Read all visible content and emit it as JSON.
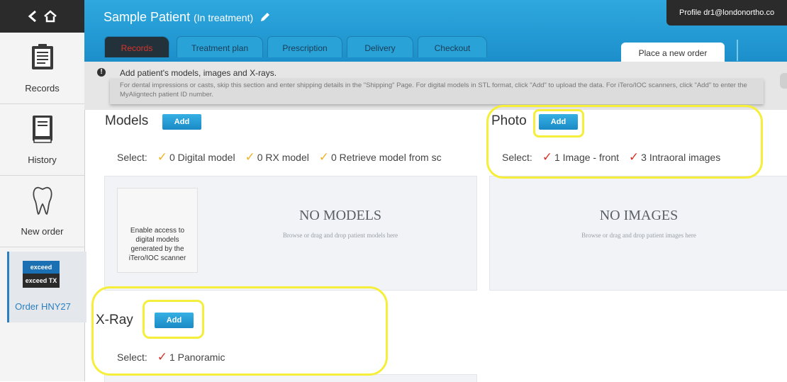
{
  "sidebar": {
    "records": "Records",
    "history": "History",
    "new_order": "New order",
    "order_badge_top": "exceed",
    "order_badge_bottom": "exceed TX",
    "order_id": "Order HNY27"
  },
  "header": {
    "patient_name": "Sample Patient",
    "status": "(In treatment)",
    "profile": "Profile  dr1@londonortho.co"
  },
  "tabs": [
    "Records",
    "Treatment plan",
    "Prescription",
    "Delivery",
    "Checkout"
  ],
  "place_order": "Place a new order",
  "info": {
    "title": "Add patient's models, images and X-rays.",
    "text": "For dental impressions or casts, skip this section and enter shipping details in the \"Shipping\" Page. For digital models in STL format, click \"Add\" to upload the data. For iTero/IOC scanners, click \"Add\" to enter the MyAligntech patient ID number."
  },
  "add_label": "Add",
  "select_label": "Select:",
  "models": {
    "title": "Models",
    "options": [
      "0 Digital model",
      "0 RX model",
      "0 Retrieve model from sc"
    ],
    "empty_title": "NO MODELS",
    "empty_hint": "Browse or drag and drop patient models here",
    "itero_text": "Enable access to digital models generated by the iTero/IOC scanner"
  },
  "photo": {
    "title": "Photo",
    "options": [
      "1 Image - front",
      "3 Intraoral images"
    ],
    "empty_title": "NO IMAGES",
    "empty_hint": "Browse or drag and drop patient images here"
  },
  "xray": {
    "title": "X-Ray",
    "options": [
      "1 Panoramic"
    ]
  },
  "colors": {
    "header_blue": "#1c8fcb",
    "button_blue": "#1a8ac6",
    "active_tab_text": "#d9342b",
    "highlight_yellow": "#f5ee3a",
    "check_yellow": "#f0b429",
    "check_red": "#d8332b"
  }
}
